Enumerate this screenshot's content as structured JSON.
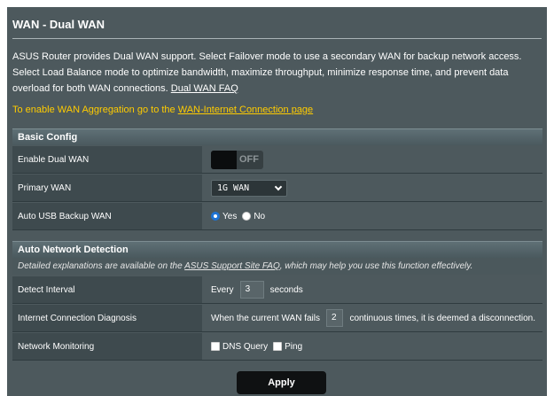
{
  "page": {
    "title": "WAN - Dual WAN",
    "description": "ASUS Router provides Dual WAN support. Select Failover mode to use a secondary WAN for backup network access. Select Load Balance mode to optimize bandwidth, maximize throughput, minimize response time, and prevent data overload for both WAN connections.",
    "faq_link": "Dual WAN FAQ",
    "aggregation_note": "To enable WAN Aggregation go to the ",
    "aggregation_link": "WAN-Internet Connection page"
  },
  "basic_config": {
    "header": "Basic Config",
    "enable_dual_wan": {
      "label": "Enable Dual WAN",
      "state": "OFF"
    },
    "primary_wan": {
      "label": "Primary WAN",
      "value": "1G WAN"
    },
    "auto_usb_backup": {
      "label": "Auto USB Backup WAN",
      "yes": "Yes",
      "no": "No",
      "selected": "Yes"
    }
  },
  "auto_detection": {
    "header": "Auto Network Detection",
    "info_before": "Detailed explanations are available on the ",
    "info_link": "ASUS Support Site FAQ",
    "info_after": ", which may help you use this function effectively.",
    "detect_interval": {
      "label": "Detect Interval",
      "prefix": "Every",
      "value": "3",
      "suffix": "seconds"
    },
    "diagnosis": {
      "label": "Internet Connection Diagnosis",
      "prefix": "When the current WAN fails",
      "value": "2",
      "suffix": "continuous times, it is deemed a disconnection."
    },
    "monitoring": {
      "label": "Network Monitoring",
      "dns": "DNS Query",
      "ping": "Ping"
    }
  },
  "apply_button": "Apply",
  "colors": {
    "panel": "#4d595d",
    "label_cell": "#3e4a4e",
    "note": "#ffcc00",
    "radio_accent": "#1e73d4"
  }
}
